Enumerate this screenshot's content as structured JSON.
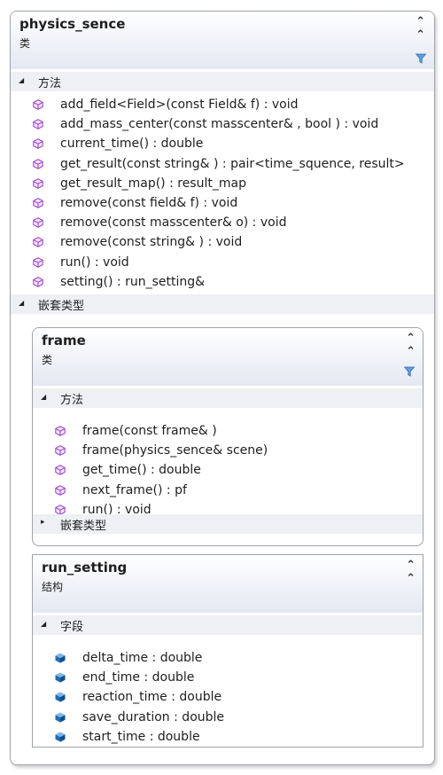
{
  "physics_sence": {
    "title": "physics_sence",
    "stereotype": "类",
    "methods_label": "方法",
    "methods": [
      "add_field<Field>(const Field& f) : void",
      "add_mass_center(const masscenter& , bool ) : void",
      "current_time() : double",
      "get_result(const string& ) : pair<time_squence, result>",
      "get_result_map() : result_map",
      "remove(const field& f) : void",
      "remove(const masscenter& o) : void",
      "remove(const string& ) : void",
      "run() : void",
      "setting() : run_setting&"
    ],
    "nested_label": "嵌套类型"
  },
  "frame": {
    "title": "frame",
    "stereotype": "类",
    "methods_label": "方法",
    "methods": [
      "frame(const frame& )",
      "frame(physics_sence& scene)",
      "get_time() : double",
      "next_frame() : pf",
      "run() : void"
    ],
    "nested_label": "嵌套类型"
  },
  "run_setting": {
    "title": "run_setting",
    "stereotype": "结构",
    "fields_label": "字段",
    "fields": [
      "delta_time : double",
      "end_time : double",
      "reaction_time : double",
      "save_duration : double",
      "start_time : double"
    ]
  },
  "colors": {
    "method_icon": "#a04ad0",
    "field_icon": "#1c6fb8",
    "border": "#9ea3ab",
    "header_gradient_end": "#e4e8f2"
  },
  "icons": {
    "collapse": "chevron-double-up-icon",
    "filter": "filter-icon",
    "method": "method-cube-icon",
    "field": "field-cube-icon"
  }
}
